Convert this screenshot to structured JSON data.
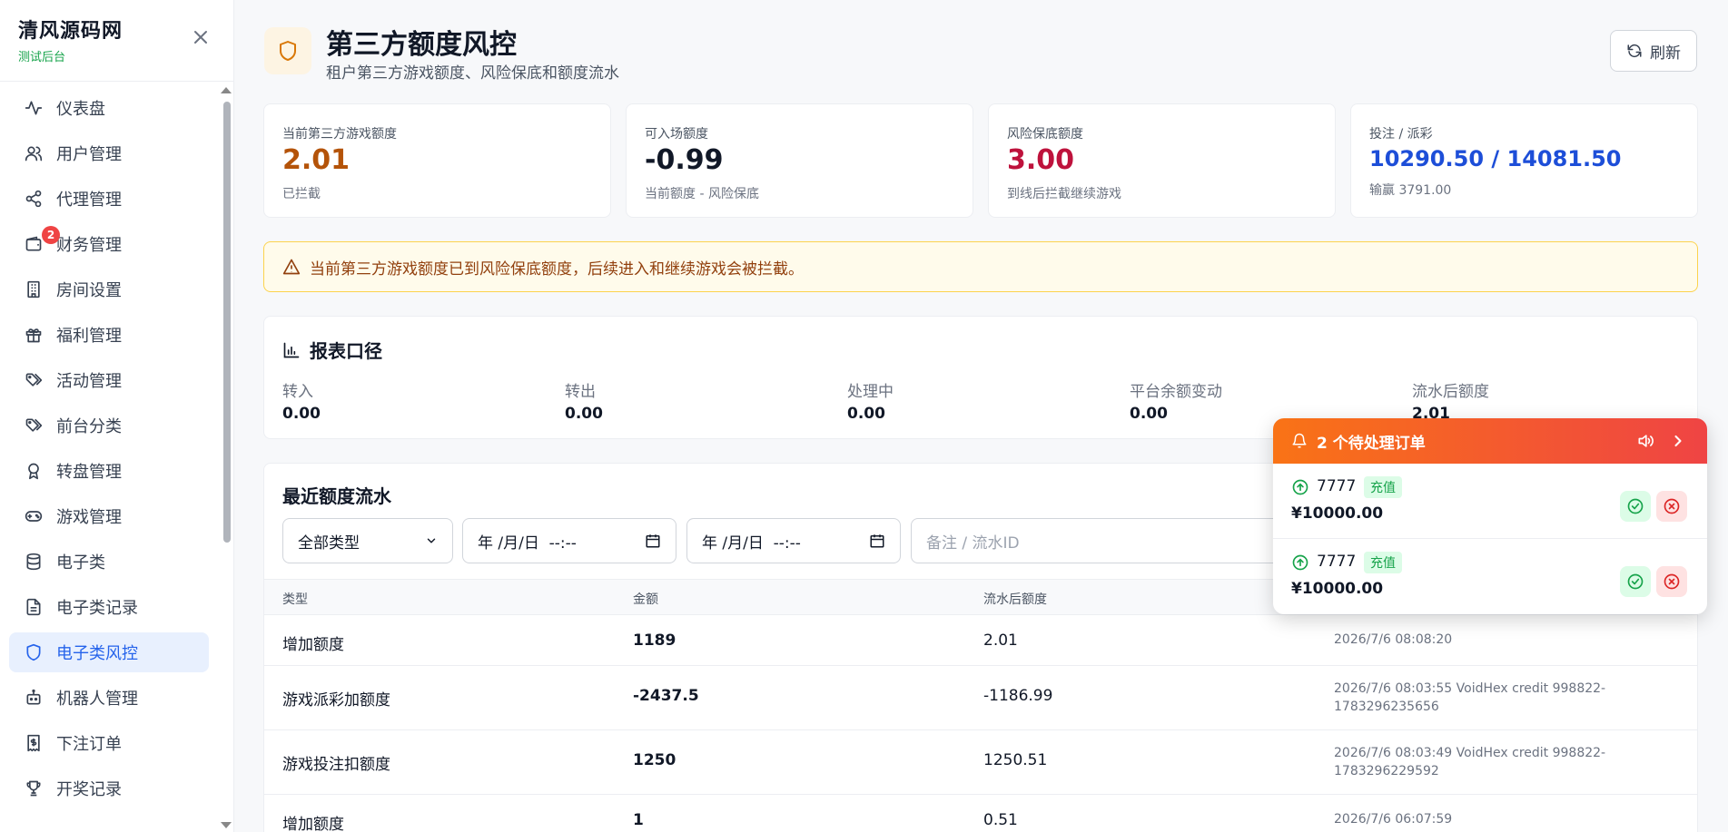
{
  "sidebar": {
    "brand_title": "清风源码网",
    "brand_sub": "测试后台",
    "items": [
      {
        "label": "仪表盘",
        "icon": "activity-icon"
      },
      {
        "label": "用户管理",
        "icon": "users-icon"
      },
      {
        "label": "代理管理",
        "icon": "share-icon"
      },
      {
        "label": "财务管理",
        "icon": "wallet-icon",
        "badge": "2"
      },
      {
        "label": "房间设置",
        "icon": "building-icon"
      },
      {
        "label": "福利管理",
        "icon": "gift-icon"
      },
      {
        "label": "活动管理",
        "icon": "tags-icon"
      },
      {
        "label": "前台分类",
        "icon": "tags-icon"
      },
      {
        "label": "转盘管理",
        "icon": "award-icon"
      },
      {
        "label": "游戏管理",
        "icon": "gamepad-icon"
      },
      {
        "label": "电子类",
        "icon": "database-icon"
      },
      {
        "label": "电子类记录",
        "icon": "file-text-icon"
      },
      {
        "label": "电子类风控",
        "icon": "shield-icon",
        "active": true
      },
      {
        "label": "机器人管理",
        "icon": "bot-icon"
      },
      {
        "label": "下注订单",
        "icon": "receipt-icon"
      },
      {
        "label": "开奖记录",
        "icon": "trophy-icon"
      }
    ]
  },
  "header": {
    "title": "第三方额度风控",
    "subtitle": "租户第三方游戏额度、风险保底和额度流水",
    "refresh_label": "刷新"
  },
  "stats": [
    {
      "label": "当前第三方游戏额度",
      "value": "2.01",
      "note": "已拦截",
      "color": "#b45309"
    },
    {
      "label": "可入场额度",
      "value": "-0.99",
      "note": "当前额度 - 风险保底",
      "color": "#111827"
    },
    {
      "label": "风险保底额度",
      "value": "3.00",
      "note": "到线后拦截继续游戏",
      "color": "#be123c"
    },
    {
      "label": "投注 / 派彩",
      "value": "10290.50 / 14081.50",
      "note": "输赢 3791.00",
      "color": "#1d4ed8"
    }
  ],
  "alert": {
    "text": "当前第三方游戏额度已到风险保底额度，后续进入和继续游戏会被拦截。"
  },
  "report": {
    "title": "报表口径",
    "cols": [
      {
        "label": "转入",
        "value": "0.00"
      },
      {
        "label": "转出",
        "value": "0.00"
      },
      {
        "label": "处理中",
        "value": "0.00"
      },
      {
        "label": "平台余额变动",
        "value": "0.00"
      },
      {
        "label": "流水后额度",
        "value": "2.01"
      }
    ]
  },
  "flow": {
    "title": "最近额度流水",
    "type_select": "全部类型",
    "date_from": "年 /月/日  --:--",
    "date_to": "年 /月/日  --:--",
    "search_placeholder": "备注 / 流水ID",
    "headers": [
      "类型",
      "金额",
      "流水后额度"
    ],
    "rows": [
      {
        "type": "增加额度",
        "amount": "1189",
        "after": "2.01",
        "meta": "2026/7/6 08:08:20"
      },
      {
        "type": "游戏派彩加额度",
        "amount": "-2437.5",
        "after": "-1186.99",
        "meta": "2026/7/6 08:03:55 VoidHex credit 998822-1783296235656"
      },
      {
        "type": "游戏投注扣额度",
        "amount": "1250",
        "after": "1250.51",
        "meta": "2026/7/6 08:03:49 VoidHex credit 998822-1783296229592"
      },
      {
        "type": "增加额度",
        "amount": "1",
        "after": "0.51",
        "meta": "2026/7/6 06:07:59"
      }
    ]
  },
  "notification": {
    "title": "2 个待处理订单",
    "orders": [
      {
        "name": "7777",
        "tag": "充值",
        "amount": "¥10000.00"
      },
      {
        "name": "7777",
        "tag": "充值",
        "amount": "¥10000.00"
      }
    ]
  }
}
